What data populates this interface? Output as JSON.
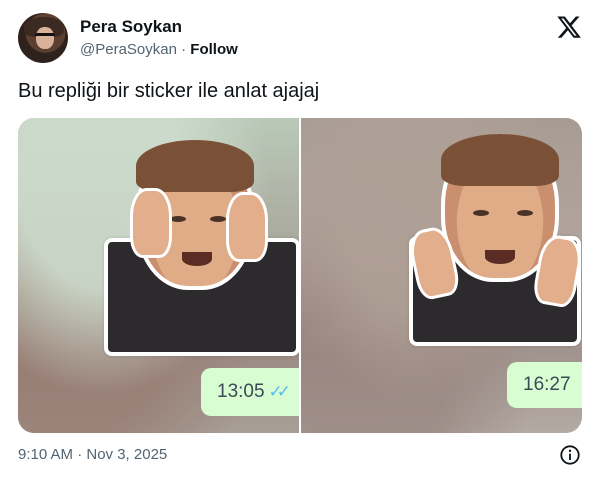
{
  "author": {
    "name": "Pera Soykan",
    "handle": "@PeraSoykan",
    "separator": "·",
    "follow_label": "Follow"
  },
  "tweet": {
    "text": "Bu repliği bir sticker ile anlat ajajaj",
    "timestamp": "9:10 AM · Nov 3, 2025"
  },
  "media": [
    {
      "bubble_time": "13:05",
      "read_ticks": "✓✓"
    },
    {
      "bubble_time": "16:27"
    }
  ],
  "icons": {
    "platform": "x-logo-icon",
    "info": "info-icon"
  },
  "colors": {
    "handle": "#536471",
    "bubble_bg": "#d9fdd3",
    "tick": "#53bdeb"
  }
}
